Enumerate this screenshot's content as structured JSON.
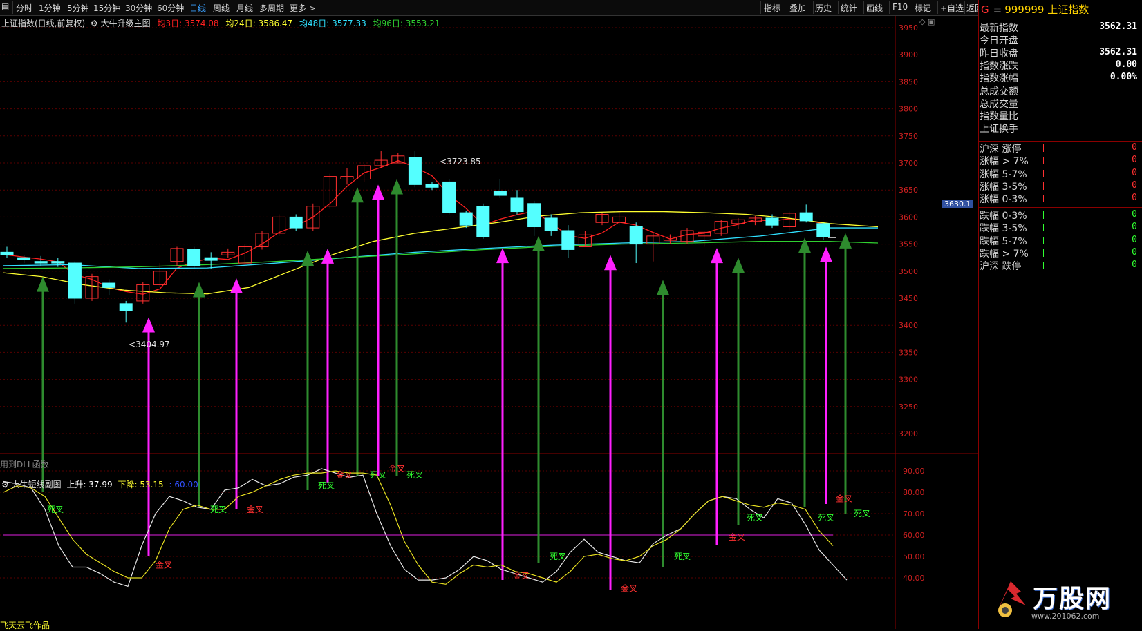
{
  "toolbar": {
    "tabs": [
      "分时",
      "1分钟",
      "5分钟",
      "15分钟",
      "30分钟",
      "60分钟",
      "日线",
      "周线",
      "月线",
      "多周期",
      "更多 >"
    ],
    "active_tab": "日线",
    "right_buttons": [
      "指标",
      "叠加",
      "历史",
      "统计",
      "画线",
      "F10",
      "标记",
      "+自选",
      "返回"
    ]
  },
  "main_chart": {
    "legend": {
      "name": "上证指数(日线,前复权)",
      "indicator": "大牛升级主图",
      "ma3": "均3日: 3574.08",
      "ma24": "均24日: 3586.47",
      "ma48": "均48日: 3577.33",
      "ma96": "均96日: 3553.21"
    },
    "high_label": "3723.85",
    "low_label": "3404.97",
    "current_price_tag": "3630.1",
    "dll_note": "用到DLL函数",
    "y_ticks": [
      "3950",
      "3900",
      "3850",
      "3800",
      "3750",
      "3700",
      "3650",
      "3600",
      "3550",
      "3500",
      "3450",
      "3400",
      "3350",
      "3300",
      "3250",
      "3200"
    ]
  },
  "sub_chart": {
    "name": "大牛短线副图",
    "up": "上升: 37.99",
    "down": "下降: 53.15",
    "level": ": 60.00",
    "y_ticks": [
      "90.00",
      "80.00",
      "70.00",
      "60.00",
      "50.00",
      "40.00"
    ],
    "cross_labels": [
      "死叉",
      "金叉",
      "死叉",
      "金叉",
      "死叉",
      "金叉",
      "死叉",
      "金叉",
      "死叉",
      "金叉",
      "死叉",
      "金叉",
      "死叉",
      "金叉",
      "死叉",
      "金叉",
      "死叉",
      "金叉",
      "死叉"
    ],
    "author_note": "飞天云飞作品"
  },
  "quote_panel": {
    "code": "999999",
    "name": "上证指数",
    "marker": "G",
    "stats": [
      {
        "label": "最新指数",
        "value": "3562.31"
      },
      {
        "label": "今日开盘",
        "value": ""
      },
      {
        "label": "昨日收盘",
        "value": "3562.31"
      },
      {
        "label": "指数涨跌",
        "value": "0.00"
      },
      {
        "label": "指数涨幅",
        "value": "0.00%"
      },
      {
        "label": "总成交额",
        "value": ""
      },
      {
        "label": "总成交量",
        "value": ""
      },
      {
        "label": "指数量比",
        "value": ""
      },
      {
        "label": "上证换手",
        "value": ""
      }
    ],
    "up_stats": [
      {
        "label": "沪深 涨停",
        "value": "0"
      },
      {
        "label": "涨幅 > 7%",
        "value": "0"
      },
      {
        "label": "涨幅 5-7%",
        "value": "0"
      },
      {
        "label": "涨幅 3-5%",
        "value": "0"
      },
      {
        "label": "涨幅 0-3%",
        "value": "0"
      }
    ],
    "down_stats": [
      {
        "label": "跌幅 0-3%",
        "value": "0"
      },
      {
        "label": "跌幅 3-5%",
        "value": "0"
      },
      {
        "label": "跌幅 5-7%",
        "value": "0"
      },
      {
        "label": "跌幅 > 7%",
        "value": "0"
      },
      {
        "label": "沪深 跌停",
        "value": "0"
      }
    ],
    "watermark_title": "万股网",
    "watermark_url": "www.201062.com"
  },
  "colors": {
    "up": "#ff3030",
    "down": "#54ffff",
    "ma3": "#ff2020",
    "ma24": "#ffff30",
    "ma48": "#30e0ff",
    "ma96": "#30d030",
    "arrow_green": "#2e8b2e",
    "arrow_magenta": "#ff20ff",
    "panel_red": "#8b0000"
  },
  "candles": [
    {
      "o": 3535,
      "c": 3530,
      "h": 3545,
      "l": 3525
    },
    {
      "o": 3525,
      "c": 3522,
      "h": 3530,
      "l": 3515
    },
    {
      "o": 3518,
      "c": 3515,
      "h": 3528,
      "l": 3510
    },
    {
      "o": 3518,
      "c": 3515,
      "h": 3525,
      "l": 3508
    },
    {
      "o": 3515,
      "c": 3450,
      "h": 3518,
      "l": 3440
    },
    {
      "o": 3450,
      "c": 3490,
      "h": 3495,
      "l": 3445
    },
    {
      "o": 3478,
      "c": 3470,
      "h": 3485,
      "l": 3455
    },
    {
      "o": 3440,
      "c": 3427,
      "h": 3445,
      "l": 3405
    },
    {
      "o": 3445,
      "c": 3475,
      "h": 3480,
      "l": 3440
    },
    {
      "o": 3475,
      "c": 3500,
      "h": 3515,
      "l": 3470
    },
    {
      "o": 3518,
      "c": 3542,
      "h": 3545,
      "l": 3510
    },
    {
      "o": 3540,
      "c": 3510,
      "h": 3545,
      "l": 3505
    },
    {
      "o": 3525,
      "c": 3520,
      "h": 3535,
      "l": 3505
    },
    {
      "o": 3530,
      "c": 3535,
      "h": 3542,
      "l": 3525
    },
    {
      "o": 3515,
      "c": 3545,
      "h": 3550,
      "l": 3510
    },
    {
      "o": 3545,
      "c": 3570,
      "h": 3575,
      "l": 3540
    },
    {
      "o": 3570,
      "c": 3600,
      "h": 3605,
      "l": 3565
    },
    {
      "o": 3600,
      "c": 3580,
      "h": 3605,
      "l": 3575
    },
    {
      "o": 3580,
      "c": 3620,
      "h": 3625,
      "l": 3575
    },
    {
      "o": 3620,
      "c": 3675,
      "h": 3680,
      "l": 3615
    },
    {
      "o": 3670,
      "c": 3675,
      "h": 3690,
      "l": 3660
    },
    {
      "o": 3670,
      "c": 3695,
      "h": 3698,
      "l": 3665
    },
    {
      "o": 3695,
      "c": 3705,
      "h": 3722,
      "l": 3690
    },
    {
      "o": 3700,
      "c": 3713,
      "h": 3718,
      "l": 3700
    },
    {
      "o": 3710,
      "c": 3660,
      "h": 3723,
      "l": 3655
    },
    {
      "o": 3660,
      "c": 3655,
      "h": 3665,
      "l": 3650
    },
    {
      "o": 3665,
      "c": 3608,
      "h": 3670,
      "l": 3605
    },
    {
      "o": 3608,
      "c": 3585,
      "h": 3612,
      "l": 3580
    },
    {
      "o": 3620,
      "c": 3563,
      "h": 3625,
      "l": 3560
    },
    {
      "o": 3648,
      "c": 3640,
      "h": 3670,
      "l": 3635
    },
    {
      "o": 3635,
      "c": 3610,
      "h": 3650,
      "l": 3605
    },
    {
      "o": 3625,
      "c": 3582,
      "h": 3630,
      "l": 3565
    },
    {
      "o": 3598,
      "c": 3575,
      "h": 3605,
      "l": 3565
    },
    {
      "o": 3575,
      "c": 3540,
      "h": 3585,
      "l": 3525
    },
    {
      "o": 3545,
      "c": 3567,
      "h": 3575,
      "l": 3545
    },
    {
      "o": 3590,
      "c": 3605,
      "h": 3608,
      "l": 3585
    },
    {
      "o": 3590,
      "c": 3600,
      "h": 3612,
      "l": 3585
    },
    {
      "o": 3583,
      "c": 3550,
      "h": 3590,
      "l": 3515
    },
    {
      "o": 3550,
      "c": 3565,
      "h": 3570,
      "l": 3518
    },
    {
      "o": 3557,
      "c": 3563,
      "h": 3568,
      "l": 3550
    },
    {
      "o": 3555,
      "c": 3575,
      "h": 3580,
      "l": 3550
    },
    {
      "o": 3565,
      "c": 3572,
      "h": 3575,
      "l": 3545
    },
    {
      "o": 3570,
      "c": 3592,
      "h": 3595,
      "l": 3565
    },
    {
      "o": 3588,
      "c": 3595,
      "h": 3598,
      "l": 3578
    },
    {
      "o": 3592,
      "c": 3598,
      "h": 3602,
      "l": 3585
    },
    {
      "o": 3598,
      "c": 3585,
      "h": 3605,
      "l": 3580
    },
    {
      "o": 3582,
      "c": 3607,
      "h": 3610,
      "l": 3575
    },
    {
      "o": 3608,
      "c": 3593,
      "h": 3623,
      "l": 3590
    },
    {
      "o": 3588,
      "c": 3563,
      "h": 3590,
      "l": 3558
    }
  ],
  "sub_series": {
    "white": [
      85,
      84,
      82,
      72,
      55,
      45,
      45,
      42,
      38,
      36,
      55,
      70,
      78,
      76,
      73,
      72,
      81,
      82,
      86,
      83,
      84,
      87,
      88,
      91,
      89,
      87,
      88,
      70,
      55,
      44,
      39,
      39,
      40,
      44,
      50,
      48,
      44,
      42,
      40,
      38,
      43,
      52,
      58,
      52,
      50,
      48,
      47,
      56,
      60,
      63,
      70,
      76,
      78,
      77,
      72,
      68,
      77,
      75,
      65,
      53,
      46,
      39
    ],
    "yellow": [
      80,
      83,
      82,
      78,
      68,
      58,
      51,
      47,
      43,
      40,
      40,
      48,
      63,
      72,
      74,
      72,
      72,
      78,
      80,
      83,
      86,
      88,
      89,
      89,
      90,
      89,
      89,
      88,
      74,
      57,
      46,
      38,
      37,
      42,
      46,
      45,
      46,
      43,
      42,
      40,
      38,
      43,
      50,
      51,
      49,
      48,
      50,
      55,
      58,
      63,
      70,
      76,
      78,
      76,
      74,
      73,
      75,
      74,
      72,
      62,
      55
    ]
  },
  "green_arrows_up": [
    {
      "x": 62,
      "price_top": 3490
    },
    {
      "x": 288,
      "price_top": 3480
    },
    {
      "x": 445,
      "price_top": 3538
    },
    {
      "x": 517,
      "price_top": 3655
    },
    {
      "x": 574,
      "price_top": 3670
    },
    {
      "x": 779,
      "price_top": 3565
    },
    {
      "x": 959,
      "price_top": 3484
    },
    {
      "x": 1068,
      "price_top": 3525
    },
    {
      "x": 1164,
      "price_top": 3562
    },
    {
      "x": 1223,
      "price_top": 3570
    }
  ],
  "magenta_arrows_up": [
    {
      "x": 215,
      "price_top": 3415
    },
    {
      "x": 342,
      "price_top": 3487
    },
    {
      "x": 474,
      "price_top": 3542
    },
    {
      "x": 547,
      "price_top": 3660
    },
    {
      "x": 727,
      "price_top": 3543
    },
    {
      "x": 883,
      "price_top": 3530
    },
    {
      "x": 1037,
      "price_top": 3543
    },
    {
      "x": 1195,
      "price_top": 3545
    }
  ],
  "cross_positions": [
    {
      "x": 68,
      "v": 72,
      "t": "死叉",
      "c": "#30ff30"
    },
    {
      "x": 225,
      "v": 46,
      "t": "金叉",
      "c": "#ff3030"
    },
    {
      "x": 304,
      "v": 72,
      "t": "死叉",
      "c": "#30ff30"
    },
    {
      "x": 357,
      "v": 72,
      "t": "金叉",
      "c": "#ff3030"
    },
    {
      "x": 460,
      "v": 83,
      "t": "死叉",
      "c": "#30ff30"
    },
    {
      "x": 486,
      "v": 88,
      "t": "金叉",
      "c": "#ff3030"
    },
    {
      "x": 535,
      "v": 88,
      "t": "死叉",
      "c": "#30ff30"
    },
    {
      "x": 562,
      "v": 91,
      "t": "金叉",
      "c": "#ff3030"
    },
    {
      "x": 588,
      "v": 88,
      "t": "死叉",
      "c": "#30ff30"
    },
    {
      "x": 742,
      "v": 41,
      "t": "金叉",
      "c": "#ff3030"
    },
    {
      "x": 795,
      "v": 50,
      "t": "死叉",
      "c": "#30ff30"
    },
    {
      "x": 898,
      "v": 35,
      "t": "金叉",
      "c": "#ff3030"
    },
    {
      "x": 975,
      "v": 50,
      "t": "死叉",
      "c": "#30ff30"
    },
    {
      "x": 1054,
      "v": 59,
      "t": "金叉",
      "c": "#ff3030"
    },
    {
      "x": 1080,
      "v": 68,
      "t": "死叉",
      "c": "#30ff30"
    },
    {
      "x": 1183,
      "v": 68,
      "t": "死叉",
      "c": "#30ff30"
    },
    {
      "x": 1209,
      "v": 77,
      "t": "金叉",
      "c": "#ff3030"
    },
    {
      "x": 1235,
      "v": 70,
      "t": "死叉",
      "c": "#30ff30"
    }
  ]
}
